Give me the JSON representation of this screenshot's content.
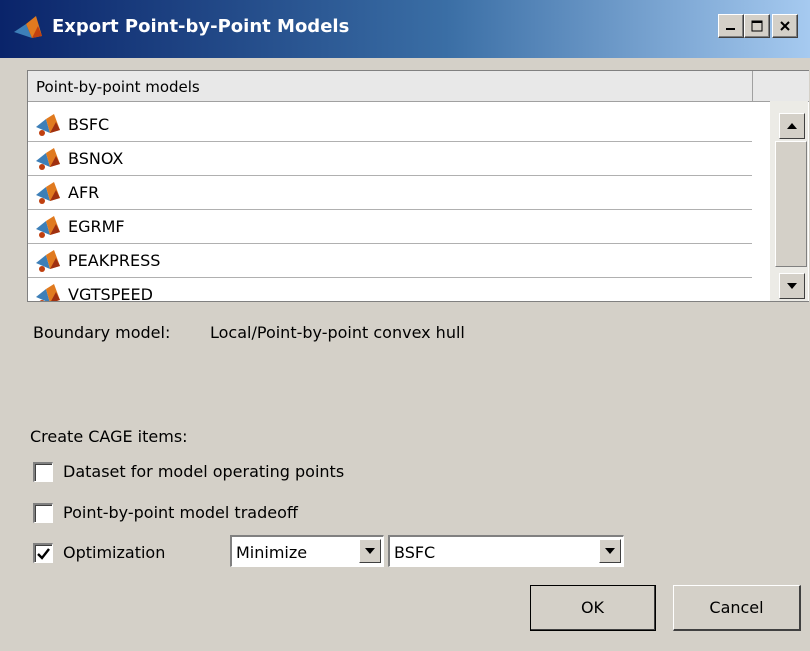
{
  "window": {
    "title": "Export Point-by-Point Models",
    "controls": {
      "minimize": "minimize-icon",
      "maximize": "maximize-icon",
      "close": "close-icon"
    }
  },
  "models_table": {
    "header": "Point-by-point models",
    "rows": [
      {
        "label": "BSFC",
        "icon": "model-icon"
      },
      {
        "label": "BSNOX",
        "icon": "model-icon"
      },
      {
        "label": "AFR",
        "icon": "model-icon"
      },
      {
        "label": "EGRMF",
        "icon": "model-icon"
      },
      {
        "label": "PEAKPRESS",
        "icon": "model-icon"
      },
      {
        "label": "VGTSPEED",
        "icon": "model-icon"
      }
    ]
  },
  "boundary": {
    "label": "Boundary model:",
    "value": "Local/Point-by-point convex hull"
  },
  "cage": {
    "heading": "Create CAGE items:",
    "items": [
      {
        "label": "Dataset for model operating points",
        "checked": false
      },
      {
        "label": "Point-by-point model tradeoff",
        "checked": false
      },
      {
        "label": "Optimization",
        "checked": true
      }
    ],
    "objective_select": "Minimize",
    "model_select": "BSFC"
  },
  "buttons": {
    "ok": "OK",
    "cancel": "Cancel"
  },
  "colors": {
    "titlebar_start": "#0a246a",
    "titlebar_end": "#a6caf0",
    "dialog_bg": "#d4d0c8"
  }
}
